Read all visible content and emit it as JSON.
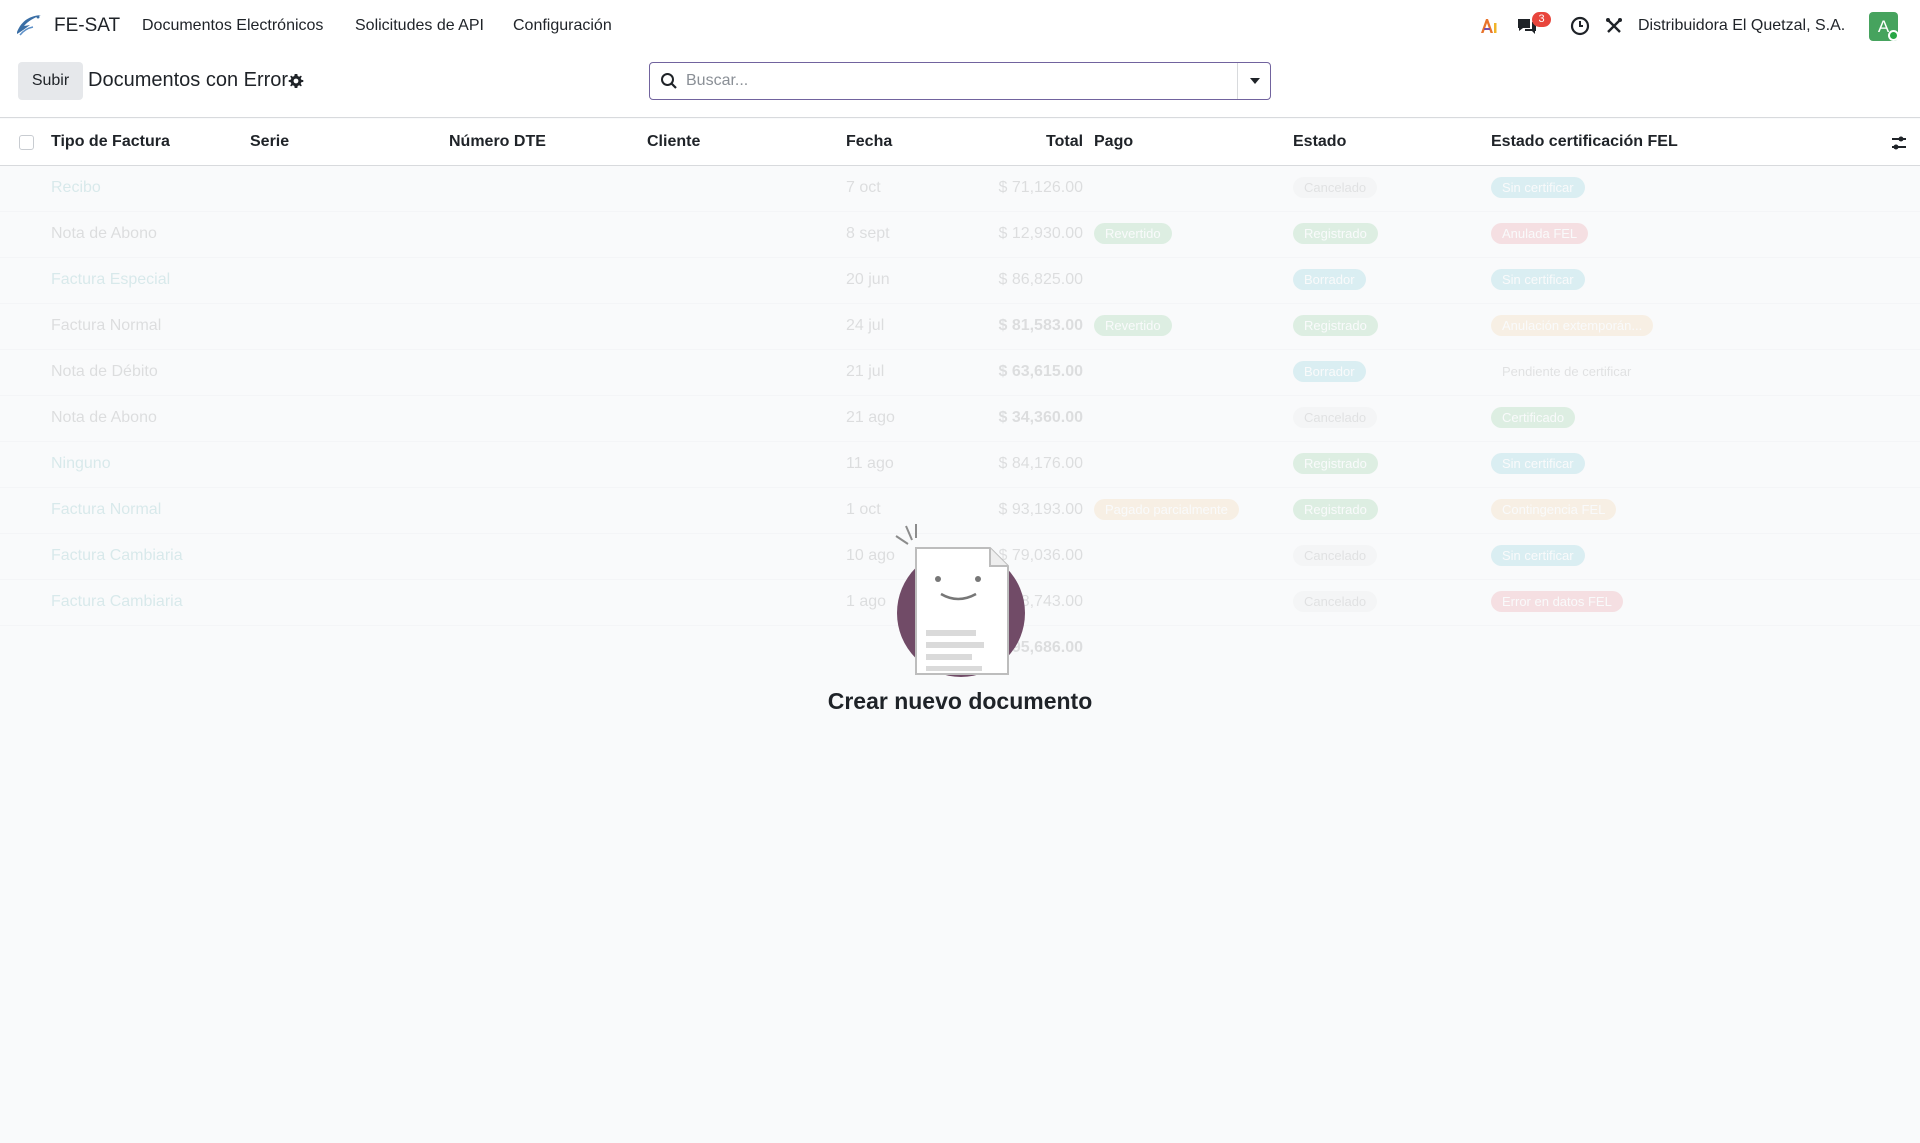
{
  "navbar": {
    "app_name": "FE-SAT",
    "menus": [
      "Documentos Electrónicos",
      "Solicitudes de API",
      "Configuración"
    ],
    "messages_badge": "3",
    "company": "Distribuidora El Quetzal, S.A.",
    "avatar_letter": "A",
    "icons": [
      "fesat-logo-icon",
      "ai-icon",
      "chat-icon",
      "clock-icon",
      "tools-icon"
    ]
  },
  "control": {
    "upload_label": "Subir",
    "title": "Documentos con Error",
    "search_placeholder": "Buscar..."
  },
  "table": {
    "headers": [
      "Tipo de Factura",
      "Serie",
      "Número DTE",
      "Cliente",
      "Fecha",
      "Total",
      "Pago",
      "Estado",
      "Estado certificación FEL"
    ],
    "rows": [
      {
        "tipo": "Recibo",
        "fecha": "7 oct",
        "total": "$ 71,126.00",
        "pago": "",
        "estado": "Cancelado",
        "fel": "Sin certificar"
      },
      {
        "tipo": "Nota de Abono",
        "fecha": "8 sept",
        "total": "$ 12,930.00",
        "pago": "Revertido",
        "estado": "Registrado",
        "fel": "Anulada FEL"
      },
      {
        "tipo": "Factura Especial",
        "fecha": "20 jun",
        "total": "$ 86,825.00",
        "pago": "",
        "estado": "Borrador",
        "fel": "Sin certificar"
      },
      {
        "tipo": "Factura Normal",
        "fecha": "24 jul",
        "total": "$ 81,583.00",
        "pago": "Revertido",
        "estado": "Registrado",
        "fel": "Anulación extemporán..."
      },
      {
        "tipo": "Nota de Débito",
        "fecha": "21 jul",
        "total": "$ 63,615.00",
        "pago": "",
        "estado": "Borrador",
        "fel": "Pendiente de certificar"
      },
      {
        "tipo": "Nota de Abono",
        "fecha": "21 ago",
        "total": "$ 34,360.00",
        "pago": "",
        "estado": "Cancelado",
        "fel": "Certificado"
      },
      {
        "tipo": "Ninguno",
        "fecha": "11 ago",
        "total": "$ 84,176.00",
        "pago": "",
        "estado": "Registrado",
        "fel": "Sin certificar"
      },
      {
        "tipo": "Factura Normal",
        "fecha": "1 oct",
        "total": "$ 93,193.00",
        "pago": "Pagado parcialmente",
        "estado": "Registrado",
        "fel": "Contingencia FEL"
      },
      {
        "tipo": "Factura Cambiaria",
        "fecha": "10 ago",
        "total": "$ 79,036.00",
        "pago": "",
        "estado": "Cancelado",
        "fel": "Sin certificar"
      },
      {
        "tipo": "Factura Cambiaria",
        "fecha": "1 ago",
        "total": "$ 88,743.00",
        "pago": "",
        "estado": "Cancelado",
        "fel": "Error en datos FEL"
      }
    ],
    "footer_total": "$ 695,686.00"
  },
  "empty_state": {
    "title": "Crear nuevo documento"
  },
  "colors": {
    "accent": "#71639e",
    "avatar": "#46a35e",
    "badge": "#e8453c"
  }
}
